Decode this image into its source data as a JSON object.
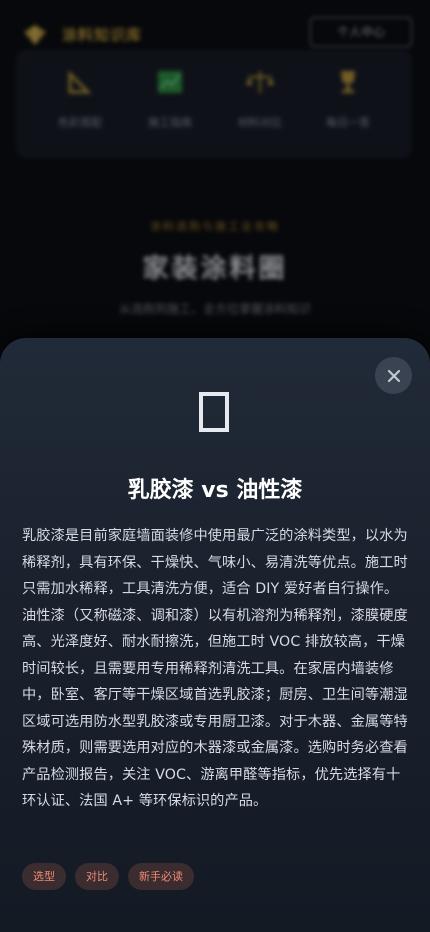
{
  "background": {
    "brand_name": "涂料知识库",
    "member_button": "个人中心",
    "quick_links": [
      {
        "label": "色彩搭配",
        "icon": "ruler-icon",
        "color": "#c9a23a"
      },
      {
        "label": "施工指南",
        "icon": "chart-icon",
        "color": "#2f9e44"
      },
      {
        "label": "材料对比",
        "icon": "scale-icon",
        "color": "#c9a23a"
      },
      {
        "label": "每日一答",
        "icon": "trophy-icon",
        "color": "#c9a23a"
      }
    ],
    "hero_kicker": "涂料选购与施工全攻略",
    "hero_title": "家装涂料圈",
    "hero_description": "从选购到施工，全方位掌握涂料知识"
  },
  "sheet": {
    "close_icon": "close-icon",
    "glyph_icon": "missing-glyph-icon",
    "title": "乳胶漆 vs 油性漆",
    "body": "乳胶漆是目前家庭墙面装修中使用最广泛的涂料类型，以水为稀释剂，具有环保、干燥快、气味小、易清洗等优点。施工时只需加水稀释，工具清洗方便，适合 DIY 爱好者自行操作。油性漆（又称磁漆、调和漆）以有机溶剂为稀释剂，漆膜硬度高、光泽度好、耐水耐擦洗，但施工时 VOC 排放较高，干燥时间较长，且需要用专用稀释剂清洗工具。在家居内墙装修中，卧室、客厅等干燥区域首选乳胶漆；厨房、卫生间等潮湿区域可选用防水型乳胶漆或专用厨卫漆。对于木器、金属等特殊材质，则需要选用对应的木器漆或金属漆。选购时务必查看产品检测报告，关注 VOC、游离甲醛等指标，优先选择有十环认证、法国 A+ 等环保标识的产品。",
    "tags": [
      "选型",
      "对比",
      "新手必读"
    ]
  },
  "colors": {
    "accent": "#f08a76",
    "gold": "#c9a23a",
    "sheet_top": "#212a38",
    "sheet_bottom": "#141a24"
  }
}
